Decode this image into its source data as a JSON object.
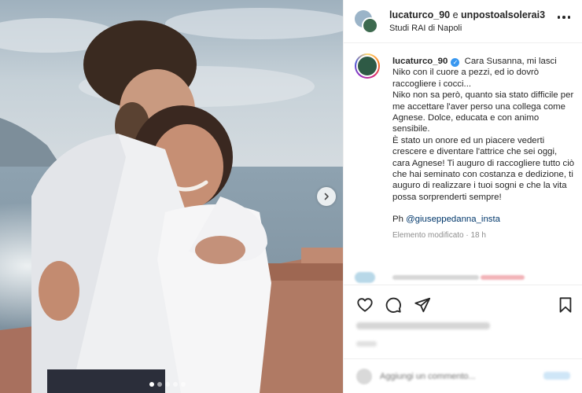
{
  "post": {
    "header": {
      "author": "lucaturco_90",
      "connector": "e",
      "coauthor": "unpostoalsolerai3",
      "location": "Studi RAI di Napoli"
    },
    "caption": {
      "username": "lucaturco_90",
      "verified": true,
      "line1": "Cara Susanna, mi lasci Niko con il cuore a pezzi, ed io dovrò raccogliere i cocci...",
      "line2": "Niko non sa però, quanto sia stato difficile per me accettare l'aver perso una collega come Agnese. Dolce, educata e con animo sensibile.",
      "line3": "È stato un onore ed un piacere vederti crescere e diventare l'attrice che sei oggi, cara Agnese! Ti auguro di raccogliere tutto ciò che hai seminato con costanza e dedizione, ti auguro di realizzare i tuoi sogni e che la vita possa sorprenderti sempre!",
      "photo_credit_prefix": "Ph ",
      "photo_credit_handle": "@giuseppedanna_insta",
      "edited_label": "Elemento modificato",
      "separator": " · ",
      "age": "18 h"
    },
    "carousel": {
      "slide_count": 5,
      "active_index": 0
    },
    "actions": {
      "like_icon": "heart-icon",
      "comment_icon": "comment-icon",
      "share_icon": "paper-plane-icon",
      "save_icon": "bookmark-icon"
    },
    "comment_box": {
      "placeholder": "Aggiungi un commento..."
    },
    "colors": {
      "accent_blue": "#3897f0",
      "mention_blue": "#00376b",
      "meta_gray": "#8e8e8e"
    }
  }
}
